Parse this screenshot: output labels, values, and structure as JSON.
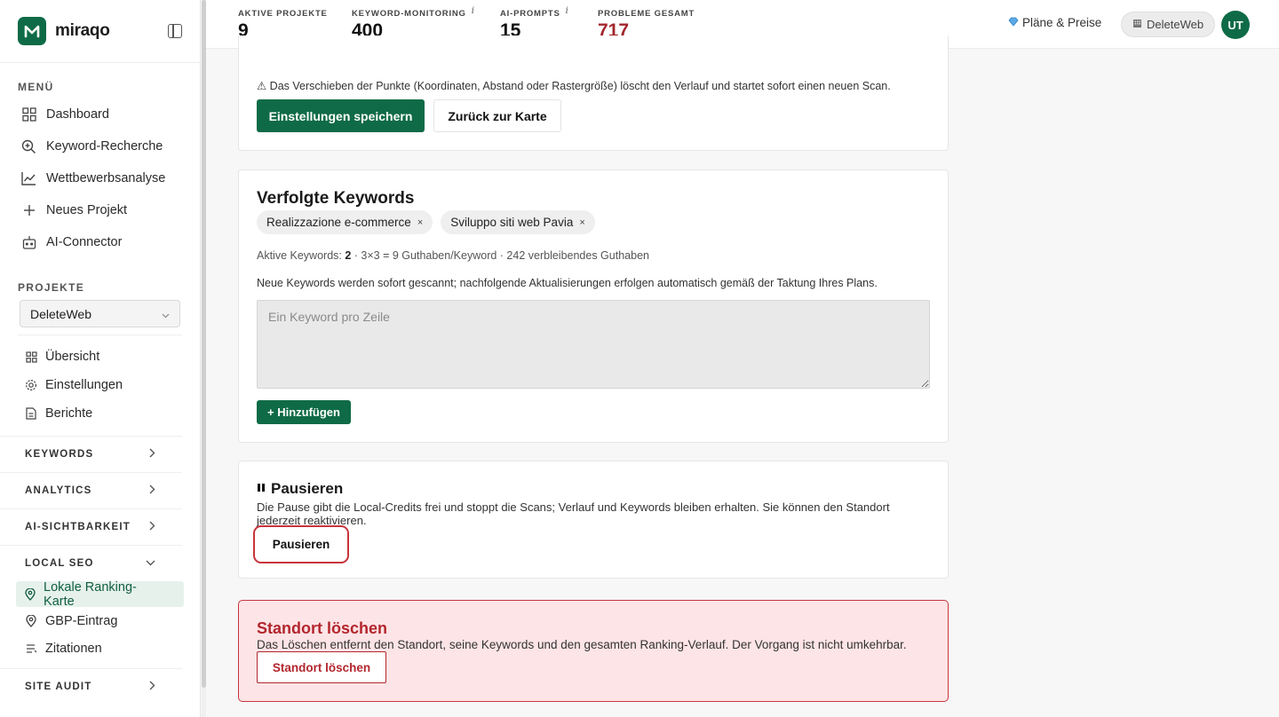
{
  "brand": {
    "name": "miraqo",
    "logo_letter": "M",
    "accent": "#0f6b47"
  },
  "sidebar": {
    "menu_label": "MENÜ",
    "menu": [
      {
        "label": "Dashboard",
        "icon": "grid-icon"
      },
      {
        "label": "Keyword-Recherche",
        "icon": "search-icon"
      },
      {
        "label": "Wettbewerbsanalyse",
        "icon": "chart-line-icon"
      },
      {
        "label": "Neues Projekt",
        "icon": "plus-icon"
      },
      {
        "label": "AI-Connector",
        "icon": "robot-icon"
      }
    ],
    "projects_label": "PROJEKTE",
    "project_selected": "DeleteWeb",
    "project_items": [
      {
        "label": "Übersicht",
        "icon": "grid-small-icon"
      },
      {
        "label": "Einstellungen",
        "icon": "gear-icon"
      },
      {
        "label": "Berichte",
        "icon": "document-icon"
      }
    ],
    "groups": [
      {
        "label": "KEYWORDS"
      },
      {
        "label": "ANALYTICS"
      },
      {
        "label": "AI-SICHTBARKEIT"
      }
    ],
    "local_seo": {
      "label": "LOCAL SEO",
      "items": [
        {
          "label": "Lokale Ranking-Karte",
          "icon": "map-pin-icon",
          "active": true
        },
        {
          "label": "GBP-Eintrag",
          "icon": "map-pin-icon"
        },
        {
          "label": "Zitationen",
          "icon": "list-icon"
        }
      ]
    },
    "site_audit_label": "SITE AUDIT"
  },
  "topbar": {
    "stats": [
      {
        "label": "AKTIVE PROJEKTE",
        "value": "9",
        "info": false
      },
      {
        "label": "KEYWORD-MONITORING",
        "value": "400",
        "info": true
      },
      {
        "label": "AI-PROMPTS",
        "value": "15",
        "info": true
      },
      {
        "label": "PROBLEME GESAMT",
        "value": "717",
        "info": false
      }
    ],
    "info_glyph": "i",
    "plans_label": "Pläne & Preise",
    "workspace_label": "DeleteWeb",
    "avatar_initials": "UT"
  },
  "settings_card": {
    "warning": "⚠ Das Verschieben der Punkte (Koordinaten, Abstand oder Rastergröße) löscht den Verlauf und startet sofort einen neuen Scan.",
    "save_label": "Einstellungen speichern",
    "back_label": "Zurück zur Karte"
  },
  "keywords_card": {
    "title": "Verfolgte Keywords",
    "chips": [
      "Realizzazione e-commerce",
      "Sviluppo siti web Pavia"
    ],
    "chip_remove": "×",
    "active_prefix": "Aktive Keywords:",
    "active_count": "2",
    "active_suffix": "· 3×3 = 9 Guthaben/Keyword · 242 verbleibendes Guthaben",
    "note": "Neue Keywords werden sofort gescannt; nachfolgende Aktualisierungen erfolgen automatisch gemäß der Taktung Ihres Plans.",
    "textarea_placeholder": "Ein Keyword pro Zeile",
    "add_label": "+ Hinzufügen"
  },
  "pause_card": {
    "title": "Pausieren",
    "description": "Die Pause gibt die Local-Credits frei und stoppt die Scans; Verlauf und Keywords bleiben erhalten. Sie können den Standort jederzeit reaktivieren.",
    "button_label": "Pausieren"
  },
  "delete_card": {
    "title": "Standort löschen",
    "description": "Das Löschen entfernt den Standort, seine Keywords und den gesamten Ranking-Verlauf. Der Vorgang ist nicht umkehrbar.",
    "button_label": "Standort löschen",
    "danger_color": "#b3262e"
  }
}
